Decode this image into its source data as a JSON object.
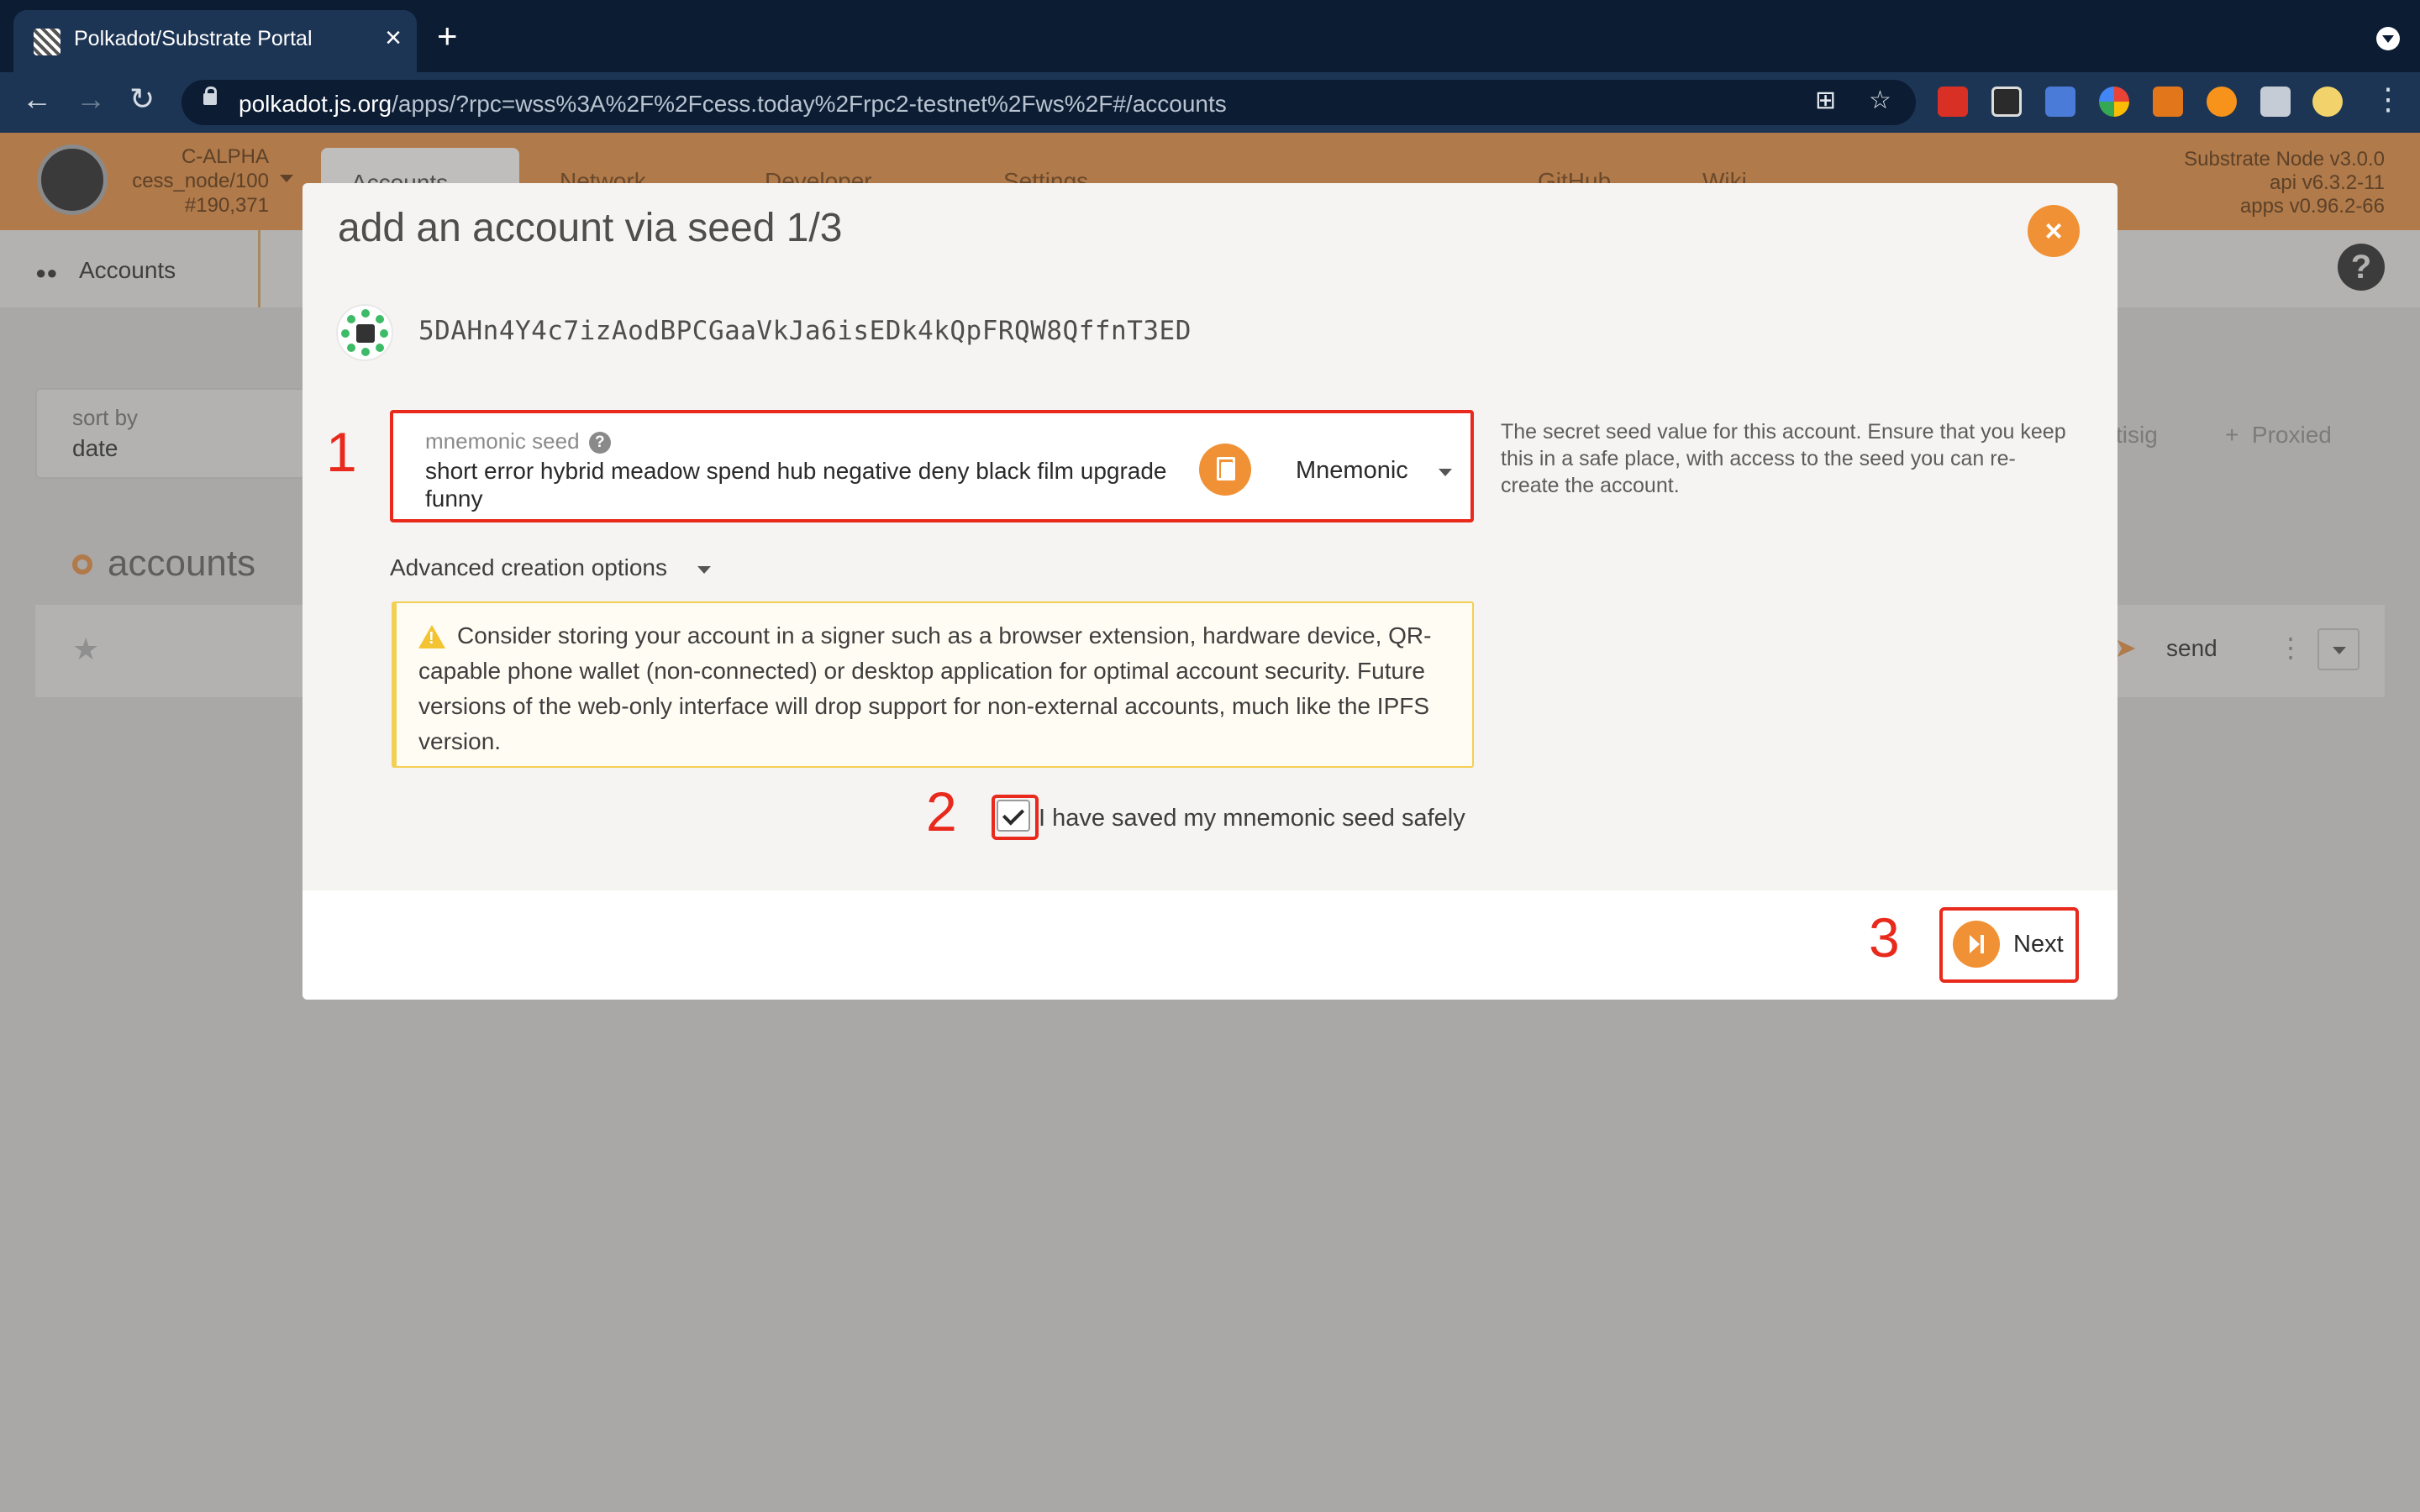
{
  "browser": {
    "tab_title": "Polkadot/Substrate Portal",
    "url_host": "polkadot.js.org",
    "url_path": "/apps/?rpc=wss%3A%2F%2Fcess.today%2Frpc2-testnet%2Fws%2F#/accounts"
  },
  "app": {
    "chain_name": "C-ALPHA",
    "node_name": "cess_node/100",
    "block": "#190,371",
    "nav": [
      "Accounts",
      "Network",
      "Developer",
      "Settings",
      "GitHub",
      "Wiki"
    ],
    "version": [
      "Substrate Node v3.0.0",
      "api v6.3.2-11",
      "apps v0.96.2-66"
    ],
    "subnav": "Accounts",
    "sort_label": "sort by",
    "sort_value": "date",
    "bg_actions": [
      "tisig",
      "Proxied"
    ],
    "section_title": "accounts",
    "row_action": "send"
  },
  "modal": {
    "title": "add an account via seed 1/3",
    "address": "5DAHn4Y4c7izAodBPCGaaVkJa6isEDk4kQpFRQW8QffnT3ED",
    "seed_label": "mnemonic seed",
    "seed_value": "short error hybrid meadow spend hub negative deny black film upgrade funny",
    "seed_type": "Mnemonic",
    "seed_help": "The secret seed value for this account. Ensure that you keep this in a safe place, with access to the seed you can re-create the account.",
    "advanced": "Advanced creation options",
    "warning": "Consider storing your account in a signer such as a browser extension, hardware device, QR-capable phone wallet (non-connected) or desktop application for optimal account security. Future versions of the web-only interface will drop support for non-external accounts, much like the IPFS version.",
    "checkbox_label": "I have saved my mnemonic seed safely",
    "checkbox_checked": true,
    "next_label": "Next"
  },
  "annotations": [
    "1",
    "2",
    "3"
  ],
  "colors": {
    "accent": "#f19135",
    "highlight": "#e8291c"
  }
}
